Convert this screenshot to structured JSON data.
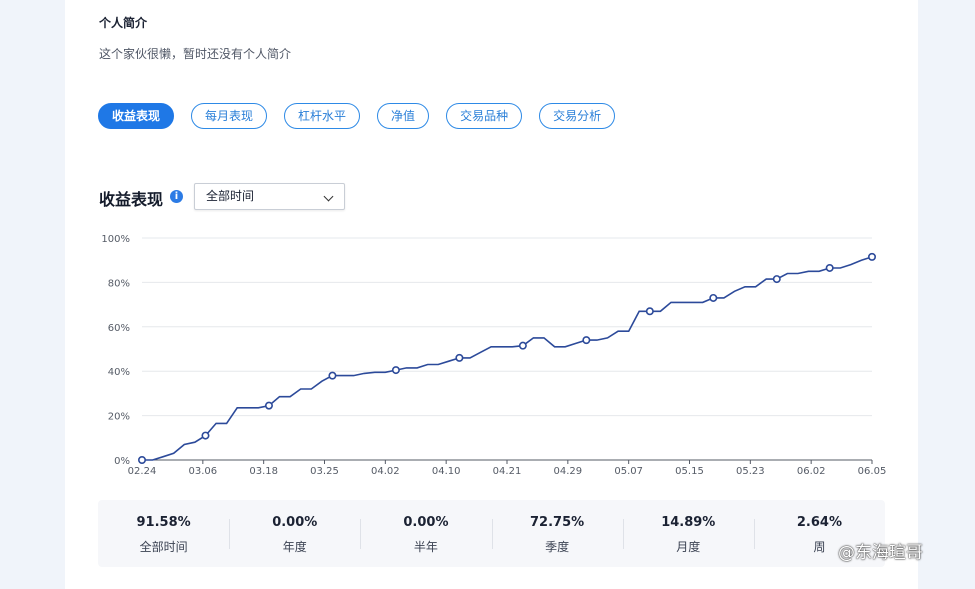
{
  "profile": {
    "bio_title": "个人简介",
    "bio_text": "这个家伙很懒，暂时还没有个人简介"
  },
  "tabs": [
    {
      "label": "收益表现",
      "active": true
    },
    {
      "label": "每月表现",
      "active": false
    },
    {
      "label": "杠杆水平",
      "active": false
    },
    {
      "label": "净值",
      "active": false
    },
    {
      "label": "交易品种",
      "active": false
    },
    {
      "label": "交易分析",
      "active": false
    }
  ],
  "section": {
    "title": "收益表现",
    "info_icon": "info-icon",
    "period_select": "全部时间"
  },
  "chart_data": {
    "type": "line",
    "title": "",
    "xlabel": "",
    "ylabel": "",
    "ylim": [
      0,
      100
    ],
    "yticks": [
      "0%",
      "20%",
      "40%",
      "60%",
      "80%",
      "100%"
    ],
    "xticks": [
      "02.24",
      "03.06",
      "03.18",
      "03.25",
      "04.02",
      "04.10",
      "04.21",
      "04.29",
      "05.07",
      "05.15",
      "05.23",
      "06.02",
      "06.05"
    ],
    "grid": true,
    "line_color": "#2c4a9a",
    "series": [
      {
        "values": [
          0,
          0,
          1.5,
          3,
          7,
          8,
          11,
          16.5,
          16.5,
          23.5,
          23.5,
          23.5,
          24.5,
          28.5,
          28.5,
          32,
          32,
          35.5,
          38,
          38,
          38,
          39,
          39.5,
          39.5,
          40.5,
          41.5,
          41.5,
          43,
          43,
          44.5,
          46,
          46,
          48.5,
          51,
          51,
          51,
          51.5,
          55,
          55,
          51,
          51,
          52.5,
          54,
          54,
          55,
          58,
          58,
          67,
          67,
          67,
          71,
          71,
          71,
          71,
          73,
          73,
          76,
          78,
          78,
          81.5,
          81.5,
          84,
          84,
          85,
          85,
          86.5,
          86.5,
          88,
          90,
          91.5
        ],
        "markers": [
          0,
          6,
          12,
          18,
          24,
          30,
          36,
          42,
          48,
          54,
          60,
          65,
          69
        ]
      }
    ]
  },
  "stats": [
    {
      "value": "91.58%",
      "label": "全部时间"
    },
    {
      "value": "0.00%",
      "label": "年度"
    },
    {
      "value": "0.00%",
      "label": "半年"
    },
    {
      "value": "72.75%",
      "label": "季度"
    },
    {
      "value": "14.89%",
      "label": "月度"
    },
    {
      "value": "2.64%",
      "label": "周"
    }
  ],
  "watermark": "@东海瑄哥"
}
